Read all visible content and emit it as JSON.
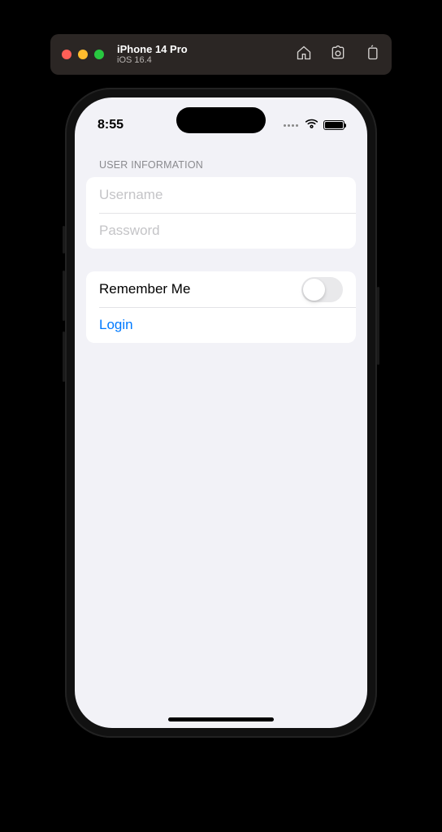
{
  "toolbar": {
    "device_name": "iPhone 14 Pro",
    "device_os": "iOS 16.4"
  },
  "status": {
    "time": "8:55"
  },
  "form": {
    "section_header": "USER INFORMATION",
    "username_placeholder": "Username",
    "username_value": "",
    "password_placeholder": "Password",
    "password_value": "",
    "remember_label": "Remember Me",
    "remember_on": false,
    "login_label": "Login"
  }
}
